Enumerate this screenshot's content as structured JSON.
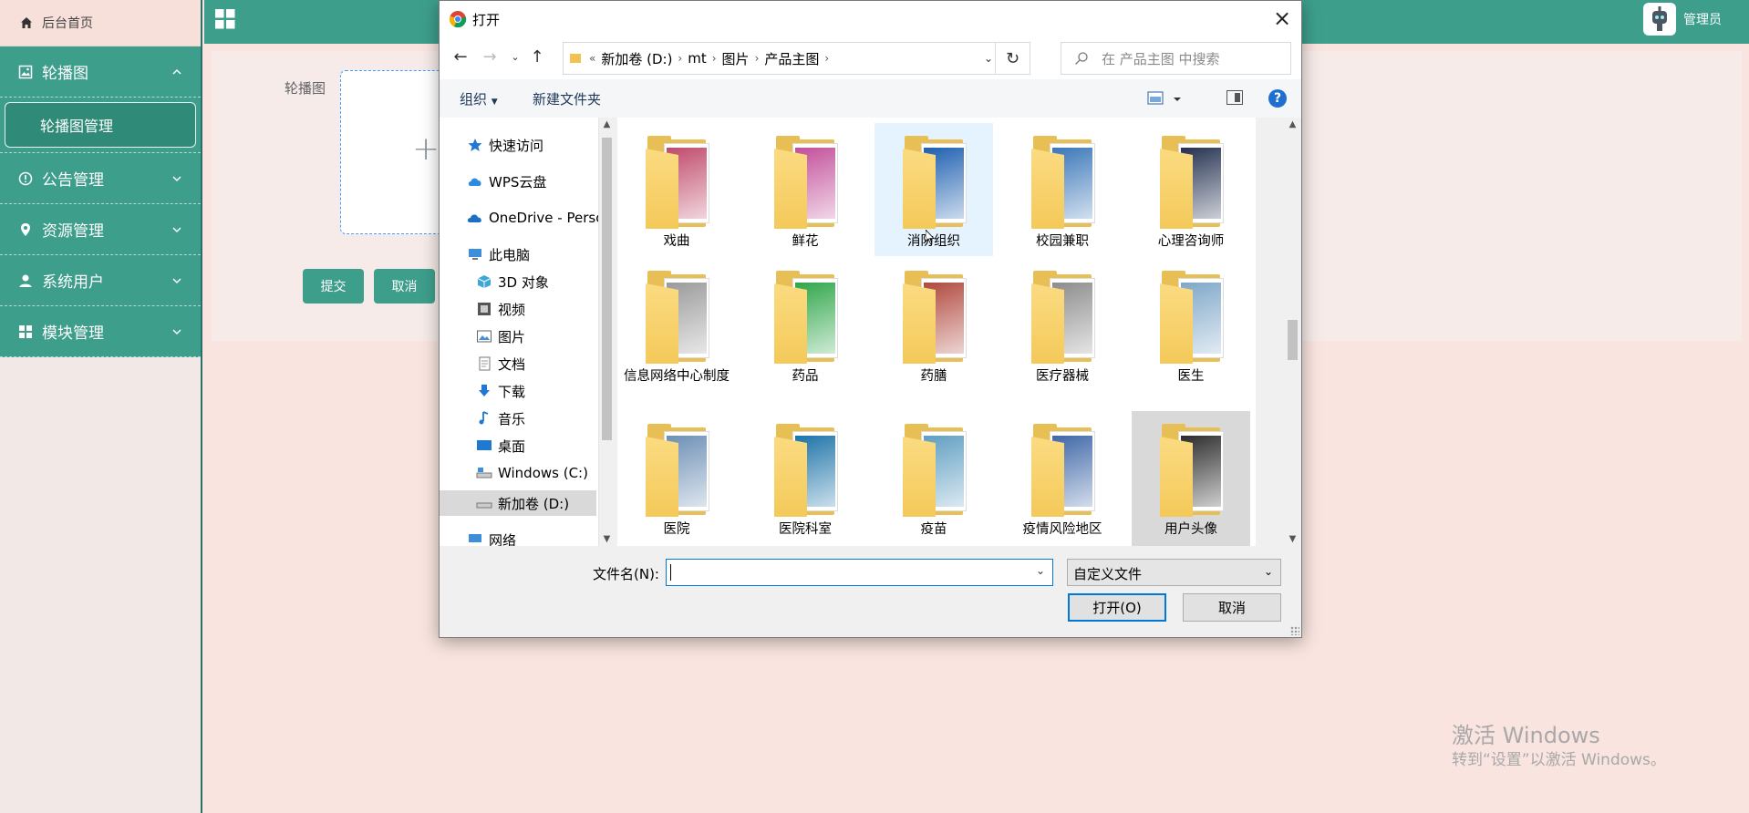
{
  "sidebar": {
    "home": "后台首页",
    "groups": [
      {
        "label": "轮播图",
        "icon": "image-icon",
        "expanded": true
      },
      {
        "label": "公告管理",
        "icon": "info-circle-icon"
      },
      {
        "label": "资源管理",
        "icon": "location-pin-icon"
      },
      {
        "label": "系统用户",
        "icon": "user-icon"
      },
      {
        "label": "模块管理",
        "icon": "grid-icon"
      }
    ],
    "sub_item": "轮播图管理"
  },
  "topbar": {
    "user": "管理员"
  },
  "form": {
    "label": "轮播图",
    "submit": "提交",
    "cancel": "取消"
  },
  "watermark": {
    "line1": "激活 Windows",
    "line2": "转到“设置”以激活 Windows。"
  },
  "dialog": {
    "title": "打开",
    "breadcrumb": [
      "新加卷 (D:)",
      "mt",
      "图片",
      "产品主图"
    ],
    "search_placeholder": "在 产品主图 中搜索",
    "toolbar": {
      "organize": "组织",
      "new_folder": "新建文件夹",
      "help": "?"
    },
    "nav": [
      {
        "label": "快速访问",
        "icon": "star-icon"
      },
      {
        "label": "WPS云盘",
        "icon": "cloud-icon"
      },
      {
        "label": "OneDrive - Perso",
        "icon": "onedrive-icon"
      },
      {
        "label": "此电脑",
        "icon": "computer-icon"
      },
      {
        "label": "3D 对象",
        "icon": "cube-icon"
      },
      {
        "label": "视频",
        "icon": "video-icon"
      },
      {
        "label": "图片",
        "icon": "picture-icon"
      },
      {
        "label": "文档",
        "icon": "document-icon"
      },
      {
        "label": "下载",
        "icon": "download-icon"
      },
      {
        "label": "音乐",
        "icon": "music-icon"
      },
      {
        "label": "桌面",
        "icon": "desktop-icon"
      },
      {
        "label": "Windows (C:)",
        "icon": "drive-icon"
      },
      {
        "label": "新加卷 (D:)",
        "icon": "drive-icon"
      },
      {
        "label": "网络",
        "icon": "network-icon"
      }
    ],
    "folders": [
      {
        "name": "戏曲",
        "color": "#c04a6a"
      },
      {
        "name": "鲜花",
        "color": "#c24f9a"
      },
      {
        "name": "消防组织",
        "color": "#1d5fb0"
      },
      {
        "name": "校园兼职",
        "color": "#3a76b8"
      },
      {
        "name": "心理咨询师",
        "color": "#23304f"
      },
      {
        "name": "信息网络中心制度",
        "color": "#9a9a9a"
      },
      {
        "name": "药品",
        "color": "#2fa64a"
      },
      {
        "name": "药膳",
        "color": "#b0483d"
      },
      {
        "name": "医疗器械",
        "color": "#8c8c8c"
      },
      {
        "name": "医生",
        "color": "#7fa7c9"
      },
      {
        "name": "医院",
        "color": "#6d8fb5"
      },
      {
        "name": "医院科室",
        "color": "#1c73a8"
      },
      {
        "name": "疫苗",
        "color": "#5f9ec2"
      },
      {
        "name": "疫情风险地区",
        "color": "#3f67a8"
      },
      {
        "name": "用户头像",
        "color": "#2b2b2b"
      }
    ],
    "filename_label": "文件名(N):",
    "filename_value": "",
    "filetype": "自定义文件",
    "open": "打开(O)",
    "cancel": "取消"
  }
}
